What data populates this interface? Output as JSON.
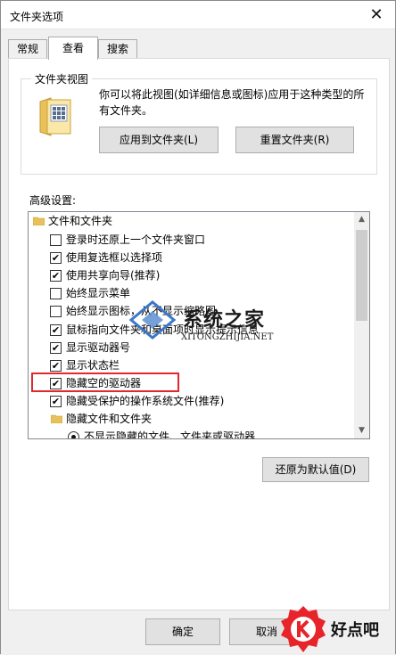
{
  "window": {
    "title": "文件夹选项"
  },
  "tabs": [
    {
      "label": "常规",
      "active": false
    },
    {
      "label": "查看",
      "active": true
    },
    {
      "label": "搜索",
      "active": false
    }
  ],
  "folder_views": {
    "group_label": "文件夹视图",
    "description": "你可以将此视图(如详细信息或图标)应用于这种类型的所有文件夹。",
    "apply_button": "应用到文件夹(L)",
    "reset_button": "重置文件夹(R)"
  },
  "advanced": {
    "label": "高级设置:",
    "items": [
      {
        "type": "folder",
        "label": "文件和文件夹",
        "indent": 0
      },
      {
        "type": "checkbox",
        "label": "登录时还原上一个文件夹窗口",
        "checked": false,
        "indent": 1
      },
      {
        "type": "checkbox",
        "label": "使用复选框以选择项",
        "checked": true,
        "indent": 1
      },
      {
        "type": "checkbox",
        "label": "使用共享向导(推荐)",
        "checked": true,
        "indent": 1
      },
      {
        "type": "checkbox",
        "label": "始终显示菜单",
        "checked": false,
        "indent": 1
      },
      {
        "type": "checkbox",
        "label": "始终显示图标，从不显示缩略图",
        "checked": false,
        "indent": 1
      },
      {
        "type": "checkbox",
        "label": "鼠标指向文件夹和桌面项时显示提示信息",
        "checked": true,
        "indent": 1
      },
      {
        "type": "checkbox",
        "label": "显示驱动器号",
        "checked": true,
        "indent": 1
      },
      {
        "type": "checkbox",
        "label": "显示状态栏",
        "checked": true,
        "indent": 1
      },
      {
        "type": "checkbox",
        "label": "隐藏空的驱动器",
        "checked": true,
        "indent": 1
      },
      {
        "type": "checkbox",
        "label": "隐藏受保护的操作系统文件(推荐)",
        "checked": true,
        "indent": 1
      },
      {
        "type": "folder",
        "label": "隐藏文件和文件夹",
        "indent": 1
      },
      {
        "type": "radio",
        "label": "不显示隐藏的文件、文件夹或驱动器",
        "checked": true,
        "indent": 2
      }
    ],
    "restore_button": "还原为默认值(D)"
  },
  "footer": {
    "ok_button": "确定",
    "cancel_button": "取消"
  },
  "watermark": {
    "main": "系统之家",
    "sub": "XITONGZHIJIA.NET"
  },
  "corner_logo": {
    "text": "好点吧"
  },
  "colors": {
    "highlight": "#e0282d",
    "logo_red": "#e8242b"
  }
}
